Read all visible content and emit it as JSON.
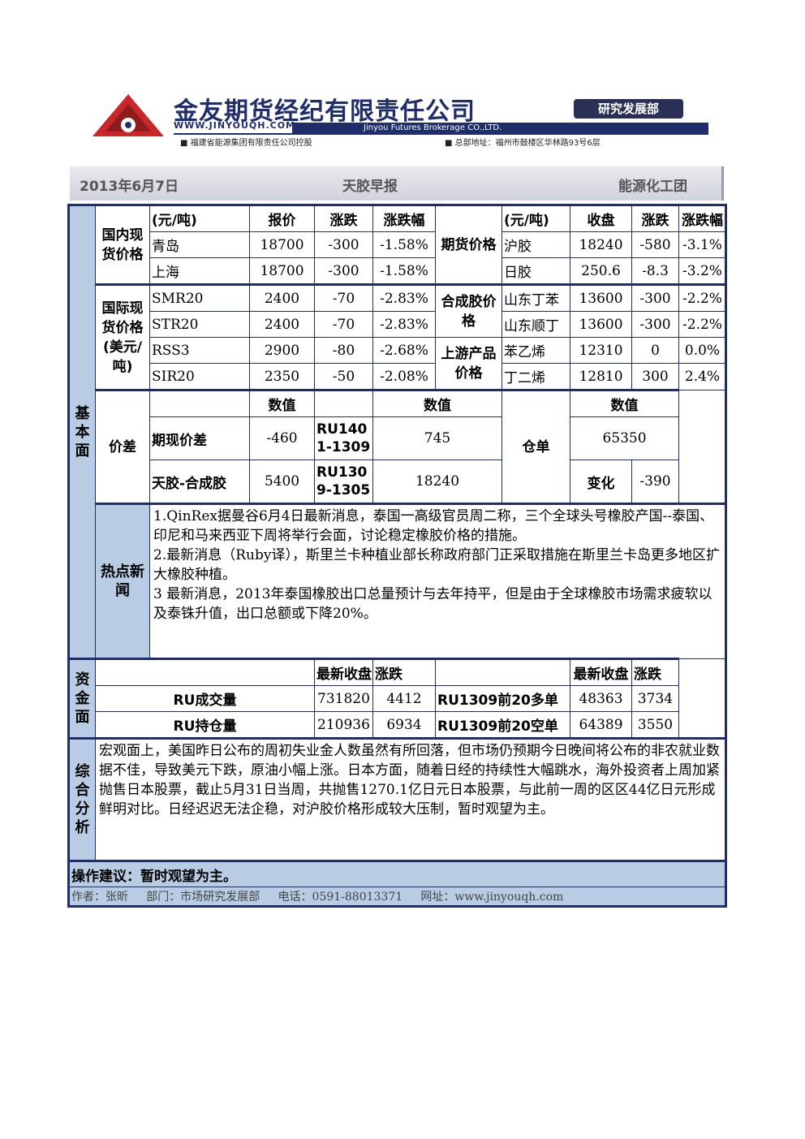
{
  "header": {
    "company_name": "金友期货经纪有限责任公司",
    "website": "WWW.JINYOUQH.COM",
    "english_name": "Jinyou Futures Brokerage CO.,LTD.",
    "dept_badge": "研究发展部",
    "sub_left": "■ 福建省能源集团有限责任公司控股",
    "sub_right": "■ 总部地址：福州市鼓楼区华林路93号6层"
  },
  "date_bar": {
    "date": "2013年6月7日",
    "title": "天胶早报",
    "group": "能源化工团"
  },
  "side_labels": {
    "basic": "基本面",
    "news": "热点新闻",
    "funds": "资金面",
    "analysis": "综合分析"
  },
  "domestic": {
    "label": "国内现货价格",
    "headers": [
      "(元/吨)",
      "报价",
      "涨跌",
      "涨跌幅"
    ],
    "rows": [
      [
        "青岛",
        "18700",
        "-300",
        "-1.58%"
      ],
      [
        "上海",
        "18700",
        "-300",
        "-1.58%"
      ]
    ]
  },
  "futures": {
    "label": "期货价格",
    "headers": [
      "(元/吨)",
      "收盘",
      "涨跌",
      "涨跌幅"
    ],
    "rows": [
      [
        "沪胶",
        "18240",
        "-580",
        "-3.1%"
      ],
      [
        "日胶",
        "250.6",
        "-8.3",
        "-3.2%"
      ]
    ]
  },
  "international": {
    "label": "国际现货价格(美元/吨)",
    "rows": [
      [
        "SMR20",
        "2400",
        "-70",
        "-2.83%"
      ],
      [
        "STR20",
        "2400",
        "-70",
        "-2.83%"
      ],
      [
        "RSS3",
        "2900",
        "-80",
        "-2.68%"
      ],
      [
        "SIR20",
        "2350",
        "-50",
        "-2.08%"
      ]
    ]
  },
  "synthetic": {
    "label": "合成胶价格",
    "rows": [
      [
        "山东丁苯",
        "13600",
        "-300",
        "-2.2%"
      ],
      [
        "山东顺丁",
        "13600",
        "-300",
        "-2.2%"
      ]
    ]
  },
  "upstream": {
    "label": "上游产品价格",
    "rows": [
      [
        "苯乙烯",
        "12310",
        "0",
        "0.0%"
      ],
      [
        "丁二烯",
        "12810",
        "300",
        "2.4%"
      ]
    ]
  },
  "spread": {
    "label": "价差",
    "value_header": "数值",
    "rows": [
      {
        "name": "期现价差",
        "value": "-460",
        "contract": "RU1401-1309",
        "contract_value": "745"
      },
      {
        "name": "天胶-合成胶",
        "value": "5400",
        "contract": "RU1309-1305",
        "contract_value": "18240"
      }
    ],
    "warehouse_label": "仓单",
    "warehouse_value": "65350",
    "change_label": "变化",
    "change_value": "-390"
  },
  "news": [
    "1.QinRex据曼谷6月4日最新消息，泰国一高级官员周二称，三个全球头号橡胶产国--泰国、印尼和马来西亚下周将举行会面，讨论稳定橡胶价格的措施。",
    "2.最新消息（Ruby译），斯里兰卡种植业部长称政府部门正采取措施在斯里兰卡岛更多地区扩大橡胶种植。",
    "3 最新消息，2013年泰国橡胶出口总量预计与去年持平，但是由于全球橡胶市场需求疲软以及泰铢升值，出口总额或下降20%。"
  ],
  "funds": {
    "headers": [
      "最新收盘",
      "涨跌",
      "最新收盘",
      "涨跌"
    ],
    "rows": [
      {
        "name": "RU成交量",
        "close": "731820",
        "chg": "4412",
        "name2": "RU1309前20多单",
        "close2": "48363",
        "chg2": "3734"
      },
      {
        "name": "RU持仓量",
        "close": "210936",
        "chg": "6934",
        "name2": "RU1309前20空单",
        "close2": "64389",
        "chg2": "3550"
      }
    ]
  },
  "analysis": "宏观面上，美国昨日公布的周初失业金人数虽然有所回落，但市场仍预期今日晚间将公布的非农就业数据不佳，导致美元下跌，原油小幅上涨。日本方面，随着日经的持续性大幅跳水，海外投资者上周加紧抛售日本股票，截止5月31日当周，共抛售1270.1亿日元日本股票，与此前一周的区区44亿日元形成鲜明对比。日经迟迟无法企稳，对沪胶价格形成较大压制，暂时观望为主。",
  "advice": "操作建议：暂时观望为主。",
  "footer": {
    "author": "作者：张昕",
    "dept": "部门：市场研究发展部",
    "phone": "电话：0591-88013371",
    "site": "网址：www.jinyouqh.com"
  },
  "colors": {
    "navy": "#1f2d6b",
    "side_fill": "#b8cce4",
    "logo_red": "#c8282a"
  }
}
